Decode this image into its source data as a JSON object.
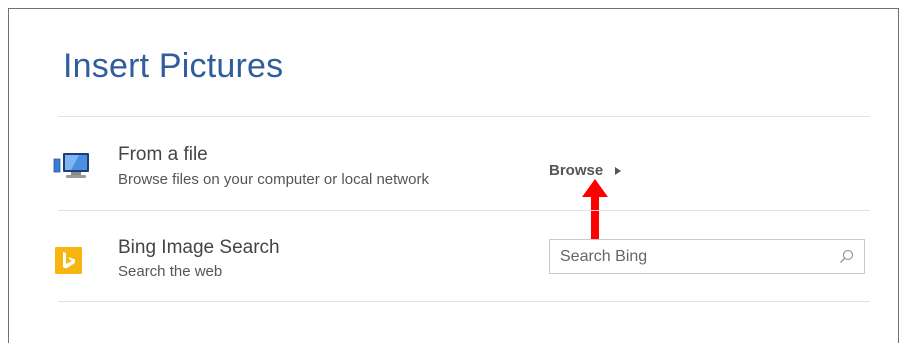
{
  "dialog": {
    "title": "Insert Pictures"
  },
  "from_file": {
    "icon": "computer-icon",
    "title": "From a file",
    "subtitle": "Browse files on your computer or local network",
    "action_label": "Browse",
    "action_icon": "triangle-right-icon"
  },
  "bing": {
    "icon": "bing-logo-icon",
    "brand_color": "#f7b50f",
    "title": "Bing Image Search",
    "subtitle": "Search the web",
    "search": {
      "value": "",
      "placeholder": "Search Bing",
      "icon": "search-icon"
    }
  },
  "annotation": {
    "icon": "red-arrow-up",
    "color": "#ff0000"
  },
  "colors": {
    "title": "#2f5d9e",
    "divider": "#e3e3e3",
    "border": "#707070"
  }
}
